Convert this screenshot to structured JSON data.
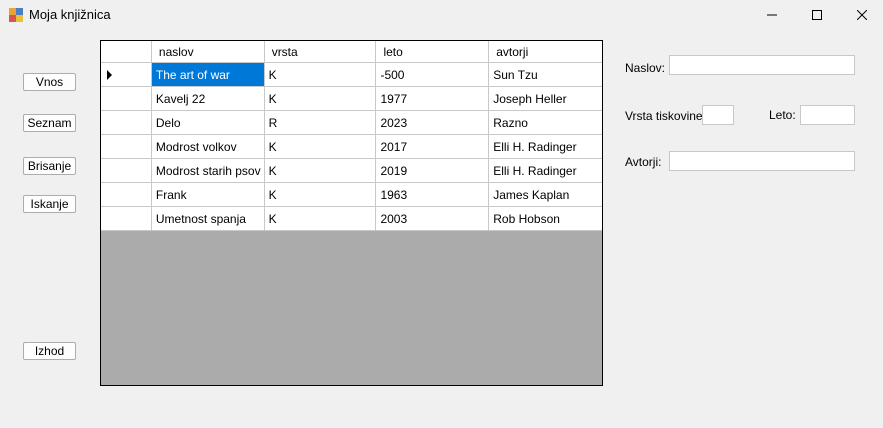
{
  "window": {
    "title": "Moja knjižnica"
  },
  "buttons": {
    "vnos": "Vnos",
    "seznam": "Seznam",
    "brisanje": "Brisanje",
    "iskanje": "Iskanje",
    "izhod": "Izhod"
  },
  "grid": {
    "columns": [
      "naslov",
      "vrsta",
      "leto",
      "avtorji"
    ],
    "rows": [
      [
        "The art of war",
        "K",
        "-500",
        "Sun Tzu"
      ],
      [
        "Kavelj 22",
        "K",
        "1977",
        "Joseph Heller"
      ],
      [
        "Delo",
        "R",
        "2023",
        "Razno"
      ],
      [
        "Modrost volkov",
        "K",
        "2017",
        "Elli H. Radinger"
      ],
      [
        "Modrost starih psov",
        "K",
        "2019",
        "Elli H. Radinger"
      ],
      [
        "Frank",
        "K",
        "1963",
        "James Kaplan"
      ],
      [
        "Umetnost spanja",
        "K",
        "2003",
        "Rob Hobson"
      ]
    ]
  },
  "form": {
    "naslov_label": "Naslov:",
    "naslov_value": "",
    "vrsta_label": "Vrsta tiskovine:",
    "vrsta_value": "",
    "leto_label": "Leto:",
    "leto_value": "",
    "avtorji_label": "Avtorji:",
    "avtorji_value": ""
  }
}
